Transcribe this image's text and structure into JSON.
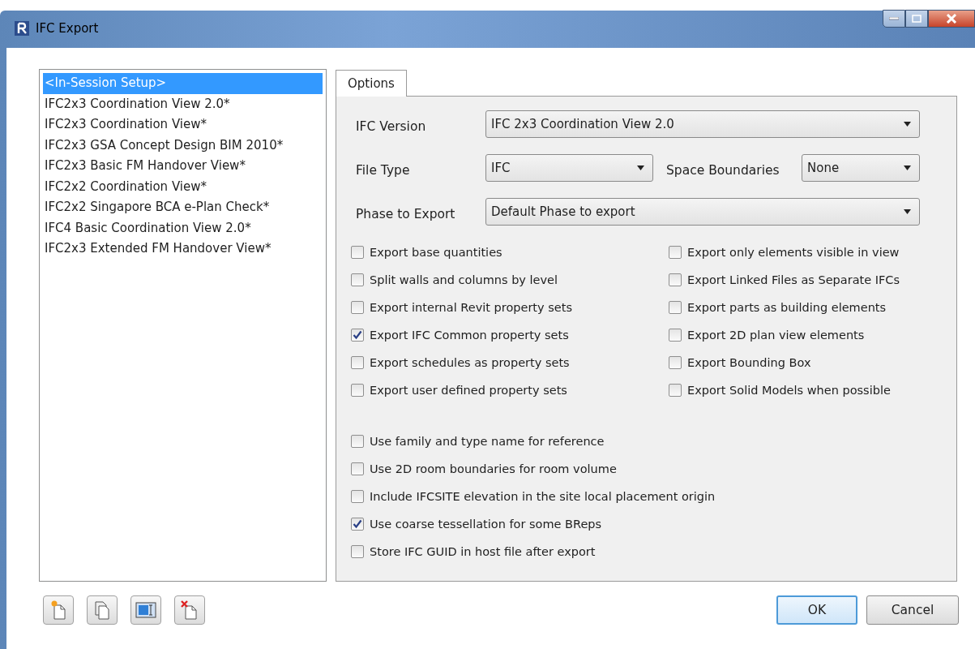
{
  "window": {
    "title": "IFC Export"
  },
  "setups": [
    {
      "label": "<In-Session Setup>",
      "selected": true
    },
    {
      "label": "IFC2x3 Coordination View 2.0*",
      "selected": false
    },
    {
      "label": "IFC2x3 Coordination View*",
      "selected": false
    },
    {
      "label": "IFC2x3 GSA Concept Design BIM 2010*",
      "selected": false
    },
    {
      "label": "IFC2x3 Basic FM Handover View*",
      "selected": false
    },
    {
      "label": "IFC2x2 Coordination View*",
      "selected": false
    },
    {
      "label": "IFC2x2 Singapore BCA e-Plan Check*",
      "selected": false
    },
    {
      "label": "IFC4 Basic Coordination View 2.0*",
      "selected": false
    },
    {
      "label": "IFC2x3 Extended FM Handover View*",
      "selected": false
    }
  ],
  "tabs": [
    {
      "label": "Options",
      "selected": true
    }
  ],
  "ifc_version": {
    "label": "IFC Version",
    "value": "IFC 2x3 Coordination View 2.0"
  },
  "file_type": {
    "label": "File Type",
    "value": "IFC"
  },
  "space_boundaries": {
    "label": "Space Boundaries",
    "value": "None"
  },
  "phase_to_export": {
    "label": "Phase to Export",
    "value": "Default Phase to export"
  },
  "options_left": [
    {
      "label": "Export base quantities",
      "checked": false
    },
    {
      "label": "Split walls and columns by level",
      "checked": false
    },
    {
      "label": "Export internal Revit property sets",
      "checked": false
    },
    {
      "label": "Export IFC Common property sets",
      "checked": true
    },
    {
      "label": "Export schedules as property sets",
      "checked": false
    },
    {
      "label": "Export user defined property sets",
      "checked": false
    }
  ],
  "options_right": [
    {
      "label": "Export only elements visible in view",
      "checked": false
    },
    {
      "label": "Export Linked Files as Separate IFCs",
      "checked": false
    },
    {
      "label": "Export parts as building elements",
      "checked": false
    },
    {
      "label": "Export 2D plan view elements",
      "checked": false
    },
    {
      "label": "Export Bounding Box",
      "checked": false
    },
    {
      "label": "Export Solid Models when possible",
      "checked": false
    }
  ],
  "options_more": [
    {
      "label": "Use family and type name for reference",
      "checked": false
    },
    {
      "label": "Use 2D room boundaries for room volume",
      "checked": false
    },
    {
      "label": "Include IFCSITE elevation in the site local placement origin",
      "checked": false
    },
    {
      "label": "Use coarse tessellation for some BReps",
      "checked": true
    },
    {
      "label": "Store IFC GUID in host file after export",
      "checked": false
    }
  ],
  "buttons": [
    {
      "label": "OK",
      "default": true
    },
    {
      "label": "Cancel",
      "default": false
    }
  ]
}
